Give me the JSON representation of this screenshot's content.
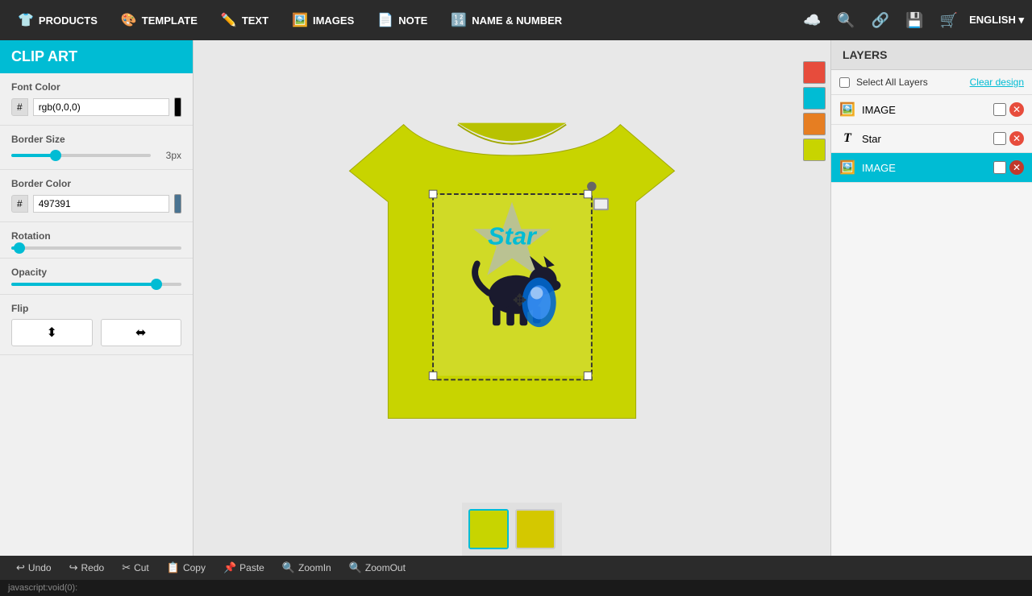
{
  "navbar": {
    "items": [
      {
        "id": "products",
        "label": "PRODUCTS",
        "icon": "👕"
      },
      {
        "id": "template",
        "label": "TEMPLATE",
        "icon": "🎨"
      },
      {
        "id": "text",
        "label": "TEXT",
        "icon": "✏️"
      },
      {
        "id": "images",
        "label": "IMAGES",
        "icon": "🖼️"
      },
      {
        "id": "note",
        "label": "NOTE",
        "icon": "📄"
      },
      {
        "id": "name-number",
        "label": "NAME & NUMBER",
        "icon": "🔢"
      }
    ],
    "right_icons": [
      "☁️",
      "🔍",
      "🔗",
      "💾",
      "🛒"
    ],
    "language": "ENGLISH"
  },
  "left_panel": {
    "title": "CLIP ART",
    "font_color": {
      "label": "Font Color",
      "hash": "#",
      "value": "rgb(0,0,0)",
      "swatch_color": "#000000"
    },
    "border_size": {
      "label": "Border Size",
      "value": 3,
      "unit": "px",
      "percent": 30
    },
    "border_color": {
      "label": "Border Color",
      "hash": "#",
      "value": "497391",
      "swatch_color": "#497391"
    },
    "rotation": {
      "label": "Rotation",
      "percent": 3
    },
    "opacity": {
      "label": "Opacity",
      "percent": 88
    },
    "flip": {
      "label": "Flip",
      "horizontal_icon": "⬍",
      "vertical_icon": "⬌"
    }
  },
  "layers": {
    "title": "LAYERS",
    "select_all_label": "Select All Layers",
    "clear_label": "Clear design",
    "items": [
      {
        "id": "image1",
        "name": "IMAGE",
        "icon": "🖼️",
        "active": false
      },
      {
        "id": "star",
        "name": "Star",
        "icon": "T",
        "active": false
      },
      {
        "id": "image2",
        "name": "IMAGE",
        "icon": "🖼️",
        "active": true
      }
    ]
  },
  "color_swatches": [
    "#e74c3c",
    "#00bcd4",
    "#e67e22",
    "#c8d400"
  ],
  "bottom_toolbar": {
    "buttons": [
      {
        "id": "undo",
        "icon": "↩",
        "label": "Undo"
      },
      {
        "id": "redo",
        "icon": "↪",
        "label": "Redo"
      },
      {
        "id": "cut",
        "icon": "✂",
        "label": "Cut"
      },
      {
        "id": "copy",
        "icon": "📋",
        "label": "Copy"
      },
      {
        "id": "paste",
        "icon": "📌",
        "label": "Paste"
      },
      {
        "id": "zoomin",
        "icon": "🔍",
        "label": "ZoomIn"
      },
      {
        "id": "zoomout",
        "icon": "🔍",
        "label": "ZoomOut"
      }
    ]
  },
  "status": {
    "text": "javascript:void(0):"
  },
  "canvas": {
    "thumbnail1_color": "#c8d400",
    "thumbnail2_color": "#d4c800"
  }
}
